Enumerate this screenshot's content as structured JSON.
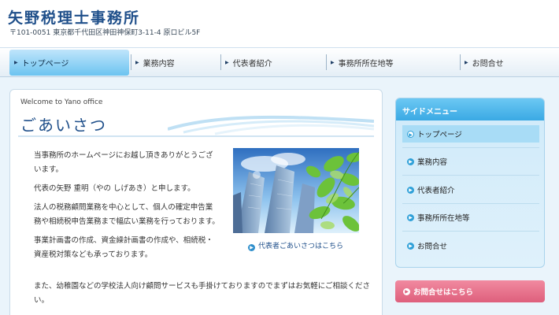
{
  "header": {
    "title": "矢野税理士事務所",
    "address": "〒101-0051 東京都千代田区神田神保町3-11-4 原ロビル5F"
  },
  "nav": {
    "items": [
      {
        "label": "トップページ"
      },
      {
        "label": "業務内容"
      },
      {
        "label": "代表者紹介"
      },
      {
        "label": "事務所所在地等"
      },
      {
        "label": "お問合せ"
      }
    ]
  },
  "main": {
    "welcome": "Welcome to Yano office",
    "title": "ごあいさつ",
    "paragraphs": [
      "当事務所のホームページにお越し頂きありがとうございます。",
      "代表の矢野 重明（やの しげあき）と申します。",
      "法人の税務顧問業務を中心として、個人の確定申告業務や相続税申告業務まで幅広い業務を行っております。",
      "事業計画書の作成、資金繰計画書の作成や、相続税・資産税対策なども承っております。",
      "また、幼稚園などの学校法人向け顧問サービスも手掛けておりますのでまずはお気軽にご相談ください。"
    ],
    "photo_link": "代表者ごあいさつはこちら"
  },
  "sidebar": {
    "title": "サイドメニュー",
    "items": [
      {
        "label": "トップページ"
      },
      {
        "label": "業務内容"
      },
      {
        "label": "代表者紹介"
      },
      {
        "label": "事務所所在地等"
      },
      {
        "label": "お問合せ"
      }
    ]
  },
  "contact_button": {
    "label": "お問合せはこちら"
  },
  "colors": {
    "brand": "#1f4f8a",
    "nav_active": "#6cc4f0",
    "contact": "#de5f7c"
  }
}
